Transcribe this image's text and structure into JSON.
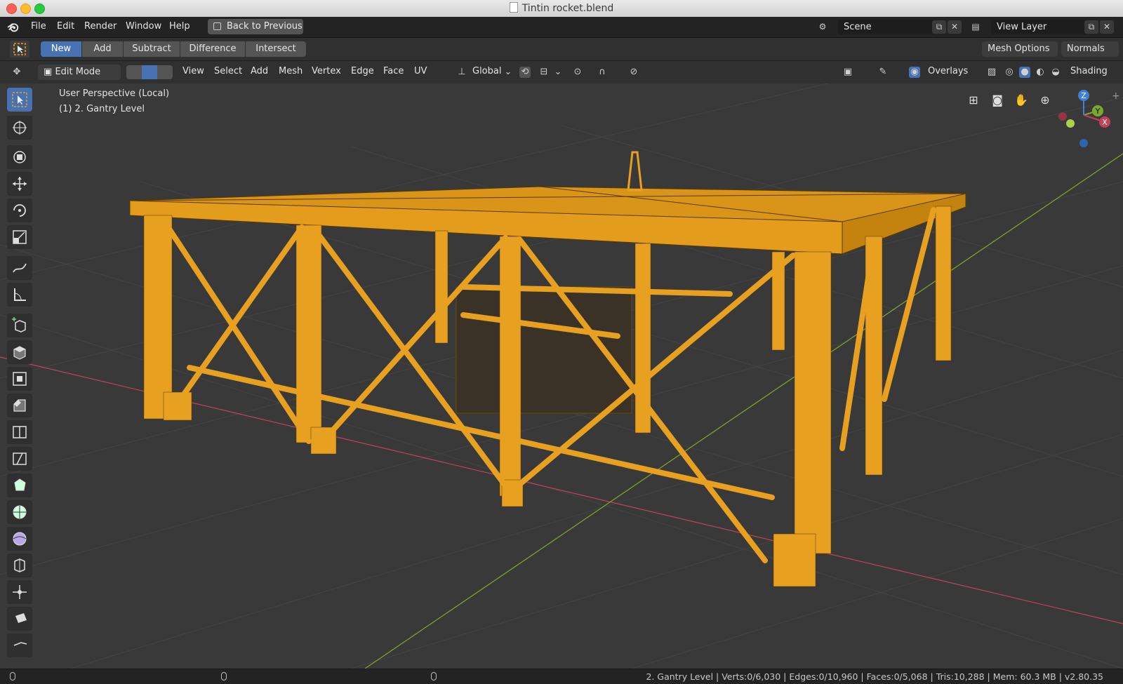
{
  "window": {
    "title": "Tintin rocket.blend"
  },
  "menubar": {
    "items": [
      "File",
      "Edit",
      "Render",
      "Window",
      "Help"
    ],
    "back_button": "Back to Previous",
    "scene": "Scene",
    "view_layer": "View Layer"
  },
  "tool_header": {
    "bool_ops": [
      "New",
      "Add",
      "Subtract",
      "Difference",
      "Intersect"
    ],
    "active_op": "New",
    "mesh_options": "Mesh Options",
    "normals": "Normals"
  },
  "viewport_header": {
    "mode": "Edit Mode",
    "menus": [
      "View",
      "Select",
      "Add",
      "Mesh",
      "Vertex",
      "Edge",
      "Face",
      "UV"
    ],
    "orientation": "Global",
    "overlays": "Overlays",
    "shading": "Shading"
  },
  "viewport": {
    "perspective": "User Perspective (Local)",
    "object": "(1) 2. Gantry Level",
    "gizmo": {
      "z": "Z",
      "y": "Y",
      "x": "X"
    },
    "mesh_color": "#e8a020"
  },
  "statusbar": {
    "text": "2. Gantry Level | Verts:0/6,030 | Edges:0/10,960 | Faces:0/5,068 | Tris:10,288 | Mem: 60.3 MB | v2.80.35"
  },
  "colors": {
    "accent": "#4772b3",
    "x_axis": "#c4415a",
    "y_axis": "#7fa62c",
    "z_axis": "#3e7fd8"
  }
}
